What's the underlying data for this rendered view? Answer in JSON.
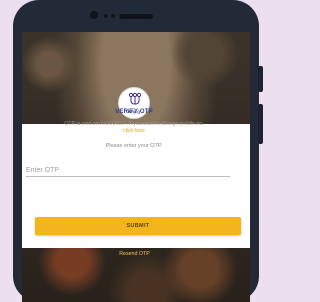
{
  "app": {
    "logo_text": "Why Q"
  },
  "otp": {
    "title": "VERIFY OTP",
    "info_text": "OTP is sent on XXXXX017. If you want to change mobile no.",
    "change_link": "click here",
    "prompt": "Please enter your OTP.",
    "input_value": "",
    "input_placeholder": "Enter OTP",
    "submit_label": "SUBMIT",
    "resend_label": "Resend OTP"
  },
  "colors": {
    "accent": "#f3b51d",
    "title": "#303a8c",
    "link": "#e3a516",
    "phone_frame": "#222a38",
    "background": "#ece0f0"
  }
}
